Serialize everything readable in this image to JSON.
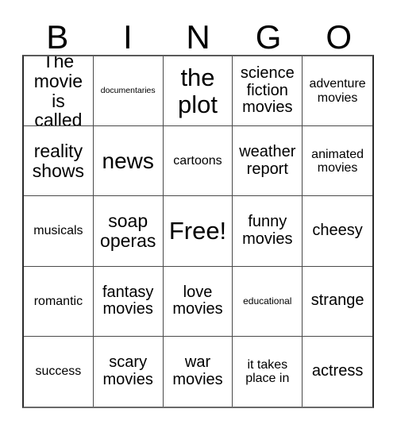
{
  "card": {
    "title_letters": [
      "B",
      "I",
      "N",
      "G",
      "O"
    ],
    "colors": {
      "background": "#ffffff",
      "text": "#000000",
      "grid_line": "#4a4a4a",
      "grid_outer": "#2b2b2b"
    },
    "rows": [
      [
        {
          "text": "The movie is called",
          "size": "lg"
        },
        {
          "text": "documentaries",
          "size": "xxs"
        },
        {
          "text": "the plot",
          "size": "xxl"
        },
        {
          "text": "science fiction movies",
          "size": "md"
        },
        {
          "text": "adventure movies",
          "size": "sm"
        }
      ],
      [
        {
          "text": "reality shows",
          "size": "lg"
        },
        {
          "text": "news",
          "size": "xl"
        },
        {
          "text": "cartoons",
          "size": "sm"
        },
        {
          "text": "weather report",
          "size": "md"
        },
        {
          "text": "animated movies",
          "size": "sm"
        }
      ],
      [
        {
          "text": "musicals",
          "size": "sm"
        },
        {
          "text": "soap operas",
          "size": "lg"
        },
        {
          "text": "Free!",
          "size": "xxl"
        },
        {
          "text": "funny movies",
          "size": "md"
        },
        {
          "text": "cheesy",
          "size": "md"
        }
      ],
      [
        {
          "text": "romantic",
          "size": "sm"
        },
        {
          "text": "fantasy movies",
          "size": "md"
        },
        {
          "text": "love movies",
          "size": "md"
        },
        {
          "text": "educational",
          "size": "xs"
        },
        {
          "text": "strange",
          "size": "md"
        }
      ],
      [
        {
          "text": "success",
          "size": "sm"
        },
        {
          "text": "scary movies",
          "size": "md"
        },
        {
          "text": "war movies",
          "size": "md"
        },
        {
          "text": "it takes place in",
          "size": "sm"
        },
        {
          "text": "actress",
          "size": "md"
        }
      ]
    ]
  }
}
